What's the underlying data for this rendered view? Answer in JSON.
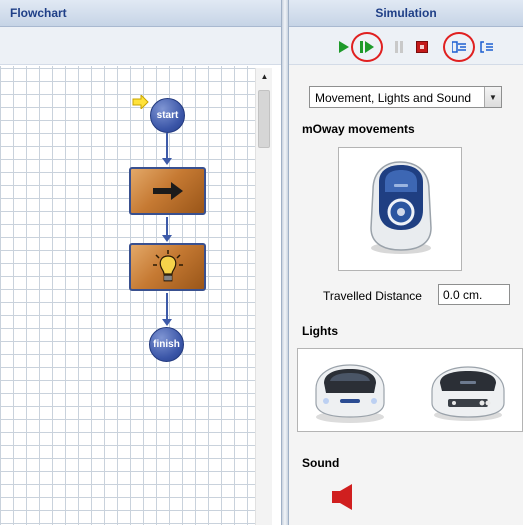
{
  "flowchart": {
    "title": "Flowchart",
    "nodes": {
      "start_label": "start",
      "finish_label": "finish",
      "move_icon": "arrow-right-icon",
      "light_icon": "lightbulb-icon"
    }
  },
  "simulation": {
    "title": "Simulation",
    "toolbar": [
      "play-icon",
      "step-icon",
      "pause-icon",
      "stop-icon",
      "step-into-icon",
      "step-out-icon"
    ],
    "mode_select": {
      "value": "Movement, Lights and Sound"
    },
    "movements": {
      "title": "mOway movements"
    },
    "distance": {
      "label": "Travelled Distance",
      "value": "0.0 cm."
    },
    "lights": {
      "title": "Lights"
    },
    "sound": {
      "title": "Sound"
    }
  },
  "colors": {
    "header_text": "#1f3f87",
    "node_blue": "#3a55a7",
    "block_orange": "#c67a33",
    "highlight_red": "#e02020",
    "play_green": "#1e9a2a"
  }
}
